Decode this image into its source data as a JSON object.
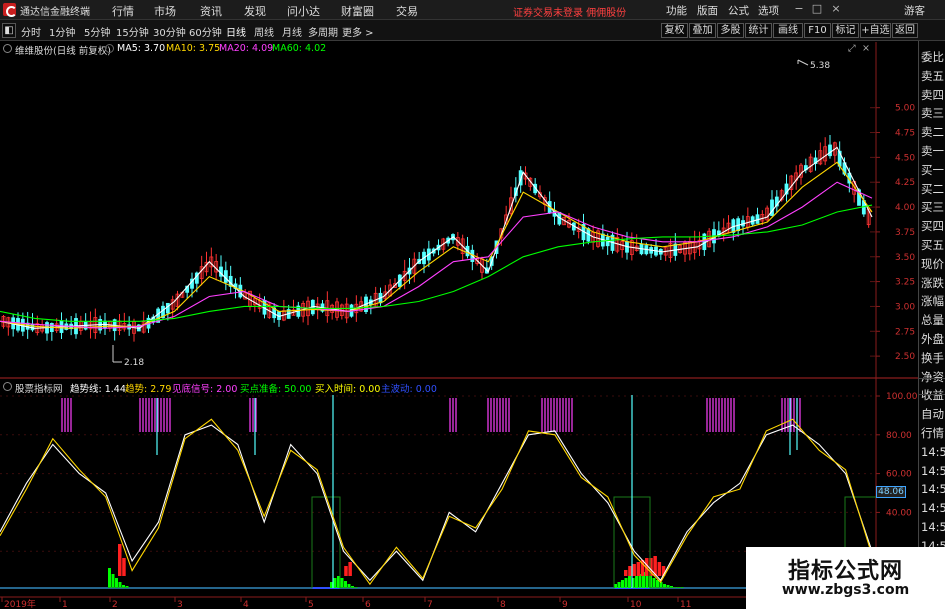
{
  "titlebar": {
    "app_title": "通达信金融终端",
    "menus": [
      "行情",
      "市场",
      "资讯",
      "发现",
      "问小达",
      "财富圈",
      "交易"
    ],
    "warning": "证券交易未登录 佣佣股份",
    "right_menus": [
      "功能",
      "版面",
      "公式",
      "选项"
    ],
    "guest": "游客",
    "window_controls": [
      "−",
      "□",
      "×"
    ]
  },
  "toolbar": {
    "periods": [
      "分时",
      "1分钟",
      "5分钟",
      "15分钟",
      "30分钟",
      "60分钟",
      "日线",
      "周线",
      "月线",
      "多周期",
      "更多 >"
    ],
    "active_period": "日线",
    "actions": [
      "复权",
      "叠加",
      "多股",
      "统计",
      "画线",
      "F10",
      "标记",
      "+自选",
      "返回"
    ]
  },
  "sidebar": {
    "items": [
      "委比",
      "卖五",
      "卖四",
      "卖三",
      "卖二",
      "卖一",
      "买一",
      "买二",
      "买三",
      "买四",
      "买五",
      "现价",
      "涨跌",
      "涨幅",
      "总量",
      "外盘",
      "换手",
      "净资",
      "收益",
      "自动",
      "行情",
      "14:5",
      "14:5",
      "14:5",
      "14:5",
      "14:5",
      "14:5",
      "14:5",
      "14:5",
      "14:5"
    ]
  },
  "upper_legend": {
    "name": "维维股份(日线 前复权)",
    "ma5": "MA5: 3.70",
    "ma10": "MA10: 3.75",
    "ma20": "MA20: 4.09",
    "ma60": "MA60: 4.02",
    "colors": {
      "ma5": "#ffffff",
      "ma10": "#ffd700",
      "ma20": "#ff40ff",
      "ma60": "#00ff00"
    }
  },
  "lower_legend": {
    "name": "股票指标网",
    "trend_line": "趋势线: 1.44",
    "trend": "趋势: 2.79",
    "bottom_signal": "见底信号: 2.00",
    "buy_prep": "买点准备: 50.00",
    "buy_time": "买入时间: 0.00",
    "main_wave": "主波动: 0.00",
    "colors": {
      "trend_line": "#ffffff",
      "trend": "#ffd700",
      "bottom_signal": "#ff40ff",
      "buy_prep": "#00ff00",
      "buy_time": "#ffff00",
      "main_wave": "#3050ff"
    }
  },
  "price_axis": {
    "ticks": [
      "5.00",
      "4.75",
      "4.50",
      "4.25",
      "4.00",
      "3.75",
      "3.50",
      "3.25",
      "3.00",
      "2.75",
      "2.50"
    ],
    "high_label": "5.38",
    "low_label": "2.18"
  },
  "indicator_axis": {
    "ticks": [
      "100.00",
      "80.00",
      "60.00",
      "40.00",
      "20.00"
    ],
    "last_value": "48.06"
  },
  "time_axis": {
    "labels": [
      "2019年",
      "1",
      "2",
      "3",
      "4",
      "5",
      "6",
      "7",
      "8",
      "9",
      "10",
      "11"
    ]
  },
  "chart_data": [
    {
      "type": "line",
      "title": "维维股份(日线 前复权)",
      "ylim": [
        2.3,
        5.5
      ],
      "series": [
        {
          "name": "MA5",
          "values": [
            2.85,
            2.78,
            2.8,
            2.82,
            2.78,
            3.05,
            3.45,
            3.1,
            2.9,
            3.0,
            2.95,
            3.1,
            3.45,
            3.7,
            3.35,
            4.35,
            3.9,
            3.7,
            3.6,
            3.55,
            3.6,
            3.8,
            3.9,
            4.35,
            4.6,
            3.9
          ]
        },
        {
          "name": "MA10",
          "values": [
            2.85,
            2.8,
            2.78,
            2.8,
            2.8,
            2.95,
            3.3,
            3.15,
            2.95,
            2.97,
            2.95,
            3.05,
            3.35,
            3.6,
            3.45,
            4.15,
            3.95,
            3.75,
            3.65,
            3.6,
            3.65,
            3.75,
            3.85,
            4.2,
            4.45,
            3.95
          ]
        },
        {
          "name": "MA20",
          "values": [
            2.85,
            2.82,
            2.8,
            2.78,
            2.8,
            2.9,
            3.1,
            3.15,
            3.0,
            2.98,
            2.95,
            3.0,
            3.2,
            3.45,
            3.5,
            3.9,
            3.95,
            3.8,
            3.7,
            3.65,
            3.65,
            3.7,
            3.8,
            4.0,
            4.25,
            4.09
          ]
        },
        {
          "name": "MA60",
          "values": [
            2.95,
            2.88,
            2.85,
            2.85,
            2.85,
            2.88,
            2.95,
            3.0,
            3.0,
            2.98,
            2.98,
            3.0,
            3.05,
            3.15,
            3.3,
            3.5,
            3.6,
            3.65,
            3.68,
            3.7,
            3.7,
            3.72,
            3.75,
            3.82,
            3.95,
            4.02
          ]
        }
      ]
    },
    {
      "type": "line",
      "title": "股票指标网",
      "ylim": [
        0,
        100
      ],
      "series": [
        {
          "name": "趋势线",
          "values": [
            30,
            55,
            75,
            60,
            50,
            15,
            35,
            80,
            85,
            75,
            35,
            75,
            60,
            20,
            5,
            20,
            5,
            40,
            30,
            55,
            80,
            82,
            60,
            45,
            20,
            5,
            30,
            45,
            55,
            80,
            85,
            75,
            60,
            20
          ]
        },
        {
          "name": "趋势",
          "values": [
            28,
            52,
            78,
            62,
            48,
            10,
            32,
            78,
            88,
            72,
            38,
            72,
            62,
            22,
            3,
            22,
            6,
            38,
            32,
            52,
            82,
            80,
            58,
            48,
            18,
            4,
            28,
            48,
            52,
            82,
            88,
            72,
            62,
            18
          ]
        }
      ]
    }
  ]
}
